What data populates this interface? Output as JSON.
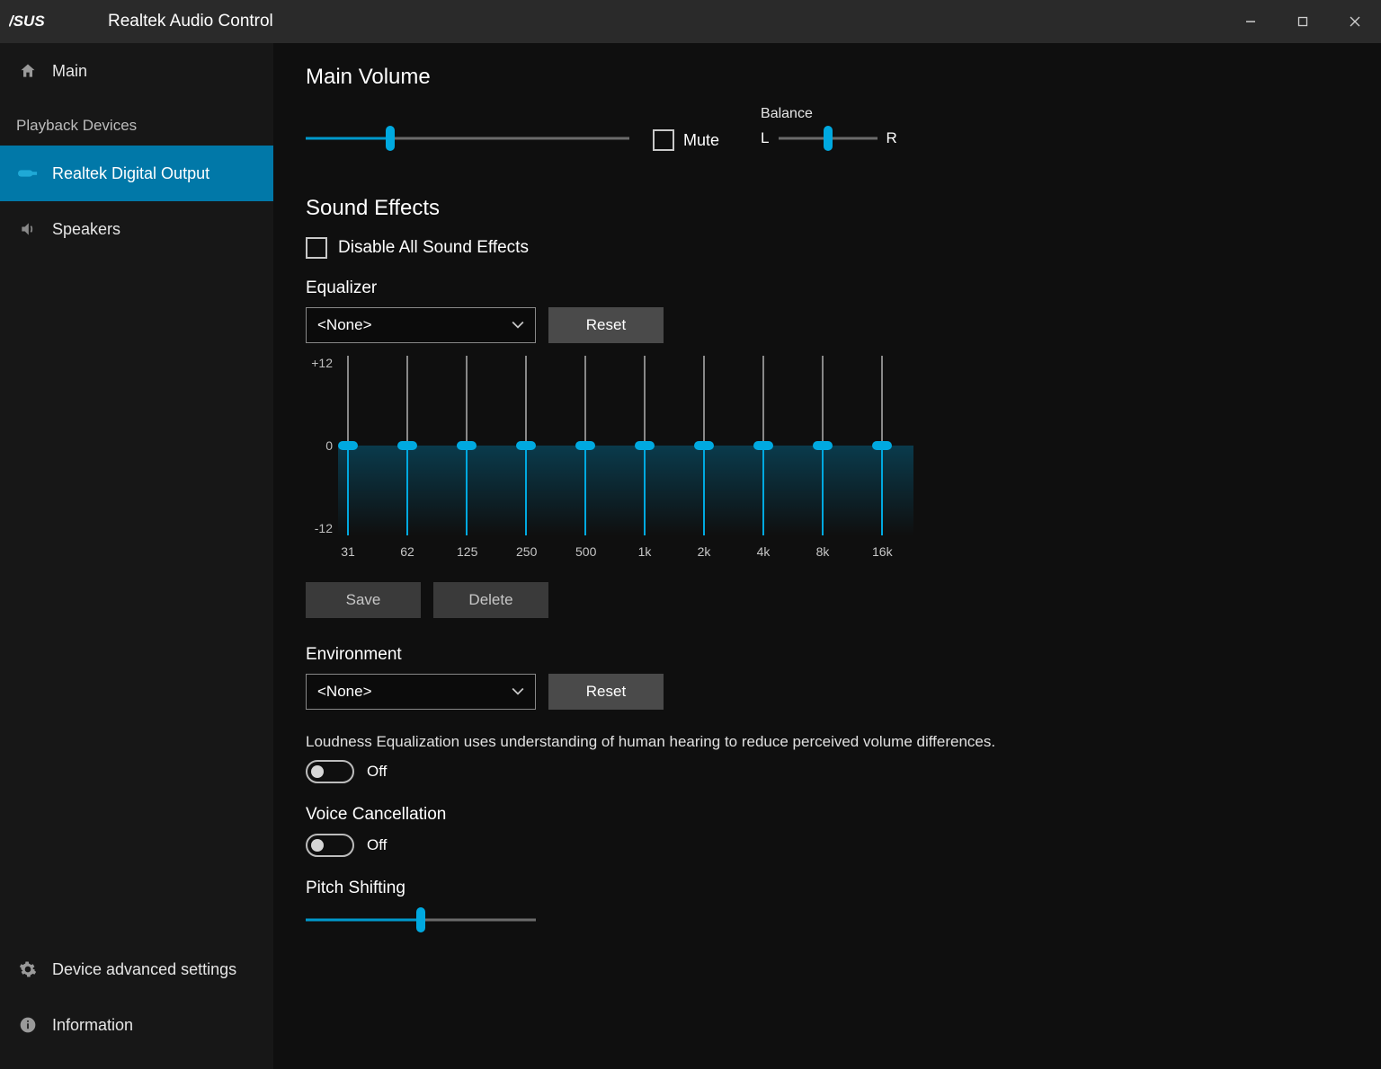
{
  "titlebar": {
    "app_title": "Realtek Audio Control"
  },
  "sidebar": {
    "main_label": "Main",
    "playback_header": "Playback Devices",
    "items": [
      {
        "label": "Realtek Digital Output",
        "active": true
      },
      {
        "label": "Speakers",
        "active": false
      }
    ],
    "advanced_label": "Device advanced settings",
    "information_label": "Information"
  },
  "main_volume": {
    "title": "Main Volume",
    "volume_percent": 26,
    "mute_label": "Mute",
    "mute_checked": false,
    "balance_label": "Balance",
    "balance_left": "L",
    "balance_right": "R",
    "balance_percent": 50
  },
  "sound_effects": {
    "title": "Sound Effects",
    "disable_all_label": "Disable All Sound Effects",
    "disable_all_checked": false
  },
  "equalizer": {
    "label": "Equalizer",
    "preset": "<None>",
    "reset_label": "Reset",
    "scale_top": "+12",
    "scale_mid": "0",
    "scale_bottom": "-12",
    "bands": [
      "31",
      "62",
      "125",
      "250",
      "500",
      "1k",
      "2k",
      "4k",
      "8k",
      "16k"
    ],
    "values": [
      0,
      0,
      0,
      0,
      0,
      0,
      0,
      0,
      0,
      0
    ],
    "save_label": "Save",
    "delete_label": "Delete"
  },
  "environment": {
    "label": "Environment",
    "preset": "<None>",
    "reset_label": "Reset"
  },
  "loudness": {
    "description": "Loudness Equalization uses understanding of human hearing to reduce perceived volume differences.",
    "state_label": "Off"
  },
  "voice_cancel": {
    "label": "Voice Cancellation",
    "state_label": "Off"
  },
  "pitch": {
    "label": "Pitch Shifting",
    "percent": 50
  },
  "colors": {
    "accent": "#00a9e0",
    "sidebar_active": "#0178a8"
  }
}
